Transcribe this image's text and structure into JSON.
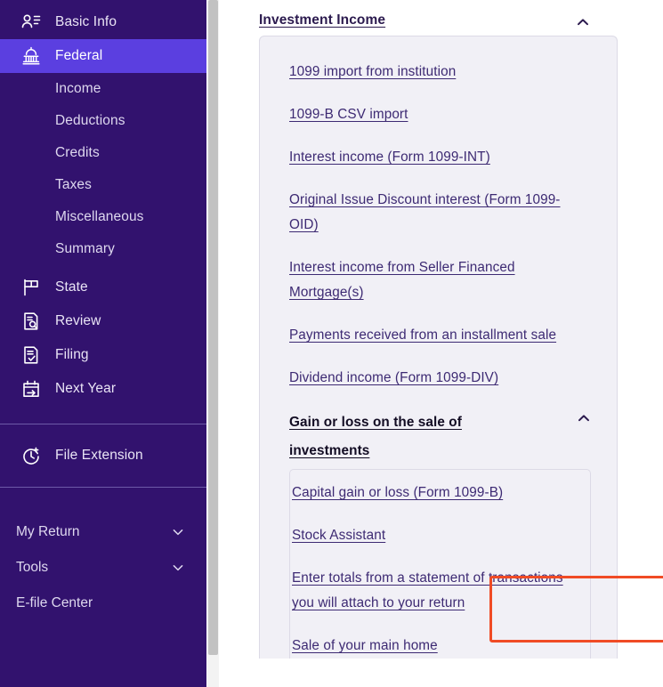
{
  "sidebar": {
    "primary_items": [
      {
        "label": "Basic Info",
        "icon": "user-card-icon",
        "active": false
      },
      {
        "label": "Federal",
        "icon": "capitol-building-icon",
        "active": true
      }
    ],
    "federal_subitems": [
      {
        "label": "Income"
      },
      {
        "label": "Deductions"
      },
      {
        "label": "Credits"
      },
      {
        "label": "Taxes"
      },
      {
        "label": "Miscellaneous"
      },
      {
        "label": "Summary"
      }
    ],
    "secondary_items": [
      {
        "label": "State",
        "icon": "flag-icon"
      },
      {
        "label": "Review",
        "icon": "document-search-icon"
      },
      {
        "label": "Filing",
        "icon": "document-check-icon"
      },
      {
        "label": "Next Year",
        "icon": "calendar-arrow-icon"
      }
    ],
    "extension_item": {
      "label": "File Extension",
      "icon": "clock-plus-icon"
    },
    "bottom_items": [
      {
        "label": "My Return",
        "icon": "chevron-down-icon",
        "expandable": true
      },
      {
        "label": "Tools",
        "icon": "chevron-down-icon",
        "expandable": true
      },
      {
        "label": "E-file Center",
        "icon": "",
        "expandable": false
      }
    ],
    "colors": {
      "background": "#32126e",
      "active": "#5b3fe0",
      "text": "#e9e4f5",
      "divider": "#6d5aa8"
    }
  },
  "main": {
    "section": {
      "title": "Investment Income",
      "caret": "chevron-up-icon",
      "expanded": true
    },
    "links": [
      "1099 import from institution",
      "1099-B CSV import",
      "Interest income (Form 1099-INT)",
      "Original Issue Discount interest (Form 1099-OID)",
      "Interest income from Seller Financed Mortgage(s)",
      "Payments received from an installment sale",
      "Dividend income (Form 1099-DIV)"
    ],
    "subsection": {
      "title": "Gain or loss on the sale of investments",
      "caret": "chevron-up-icon",
      "expanded": true,
      "links": [
        "Capital gain or loss (Form 1099-B)",
        "Stock Assistant",
        "Enter totals from a statement of transactions you will attach to your return",
        "Sale of your main home"
      ],
      "highlighted_link_index": 2
    },
    "colors": {
      "link": "#3d2a73",
      "card_background": "#f1f0f6",
      "card_border": "#dcdae6",
      "highlight_border": "#f04b25",
      "title": "#2b1a4e"
    }
  }
}
